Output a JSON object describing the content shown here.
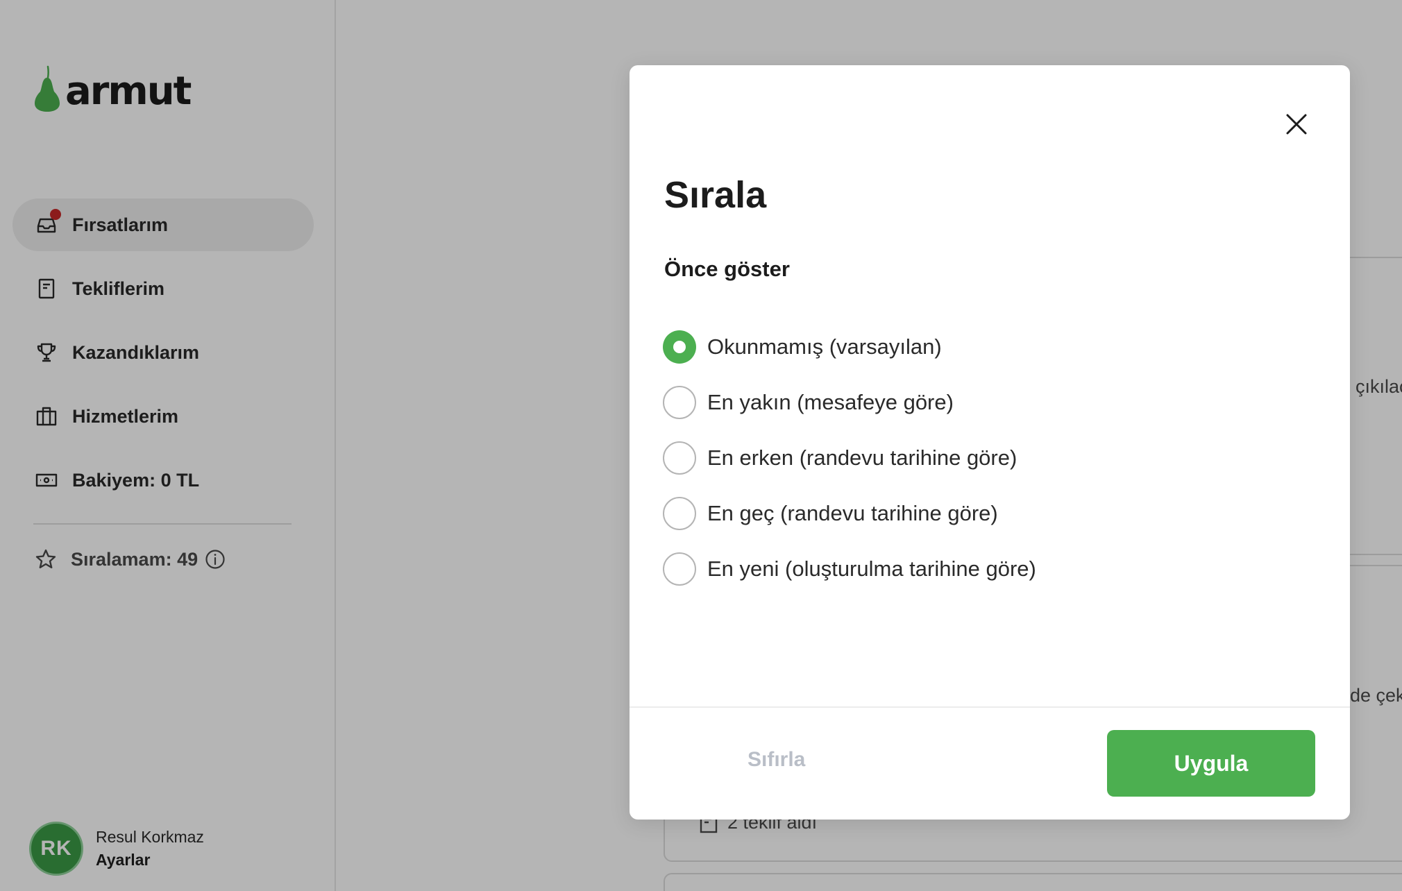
{
  "app": {
    "logo_text": "armut"
  },
  "sidebar": {
    "items": [
      {
        "label": "Fırsatlarım",
        "icon": "inbox-icon",
        "active": true,
        "has_notification": true
      },
      {
        "label": "Tekliflerim",
        "icon": "document-icon",
        "active": false
      },
      {
        "label": "Kazandıklarım",
        "icon": "trophy-icon",
        "active": false
      },
      {
        "label": "Hizmetlerim",
        "icon": "briefcase-icon",
        "active": false
      },
      {
        "label": "Bakiyem: 0 TL",
        "icon": "banknote-icon",
        "active": false
      }
    ],
    "rank_label": "Sıralamam: 49",
    "profile": {
      "initials": "RK",
      "name": "Resul Korkmaz",
      "settings_label": "Ayarlar"
    }
  },
  "background": {
    "snippet_1": "çıkılac",
    "snippet_2": "de çek",
    "snippet_3": "2 teklif aldı"
  },
  "modal": {
    "title": "Sırala",
    "section_title": "Önce göster",
    "options": [
      {
        "label": "Okunmamış (varsayılan)",
        "checked": true
      },
      {
        "label": "En yakın (mesafeye göre)",
        "checked": false
      },
      {
        "label": "En erken (randevu tarihine göre)",
        "checked": false
      },
      {
        "label": "En geç (randevu tarihine göre)",
        "checked": false
      },
      {
        "label": "En yeni (oluşturulma tarihine göre)",
        "checked": false
      }
    ],
    "reset_label": "Sıfırla",
    "apply_label": "Uygula"
  },
  "colors": {
    "brand_green": "#4caf50",
    "notification_red": "#c62828",
    "avatar_green": "#3a9a45"
  }
}
